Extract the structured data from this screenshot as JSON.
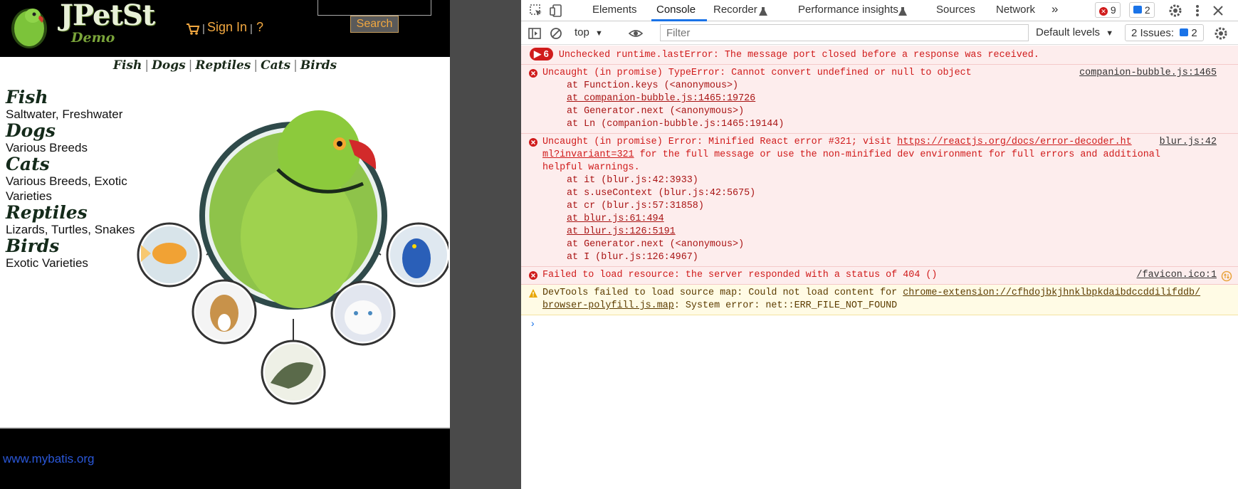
{
  "page": {
    "logo_text": "JPetSt",
    "logo_demo": "Demo",
    "sign_in": "Sign In",
    "help": "?",
    "search_button": "Search",
    "search_value": "",
    "quicklinks": [
      "Fish",
      "Dogs",
      "Reptiles",
      "Cats",
      "Birds"
    ],
    "categories": [
      {
        "title": "Fish",
        "desc": "Saltwater, Freshwater"
      },
      {
        "title": "Dogs",
        "desc": "Various Breeds"
      },
      {
        "title": "Cats",
        "desc": "Various Breeds, Exotic Varieties"
      },
      {
        "title": "Reptiles",
        "desc": "Lizards, Turtles, Snakes"
      },
      {
        "title": "Birds",
        "desc": "Exotic Varieties"
      }
    ],
    "footer_link": "www.mybatis.org"
  },
  "devtools": {
    "tabs": [
      "Elements",
      "Console",
      "Recorder",
      "Performance insights",
      "Sources",
      "Network"
    ],
    "active_tab": "Console",
    "more_tabs": "»",
    "error_count": "9",
    "message_count": "2",
    "context": "top",
    "filter_placeholder": "Filter",
    "default_levels": "Default levels",
    "issues_label": "2 Issues:",
    "issues_count": "2",
    "messages": {
      "m1": {
        "count": "6",
        "text": "Unchecked runtime.lastError: The message port closed before a response was received."
      },
      "m2": {
        "text": "Uncaught (in promise) TypeError: Cannot convert undefined or null to object",
        "source": "companion-bubble.js:1465",
        "stack": [
          "at Function.keys (<anonymous>)",
          "at companion-bubble.js:1465:19726",
          "at Generator.next (<anonymous>)",
          "at Ln (companion-bubble.js:1465:19144)"
        ]
      },
      "m3": {
        "text1": "Uncaught (in promise) Error: Minified React error #321; visit ",
        "link": "https://reactjs.org/docs/error-decoder.ht",
        "link2": "ml?invariant=321",
        "text2": " for the full message or use the non-minified dev environment for full errors and additional helpful warnings.",
        "source": "blur.js:42",
        "stack": [
          "at it (blur.js:42:3933)",
          "at s.useContext (blur.js:42:5675)",
          "at cr (blur.js:57:31858)",
          "at blur.js:61:494",
          "at blur.js:126:5191",
          "at Generator.next (<anonymous>)",
          "at I (blur.js:126:4967)"
        ]
      },
      "m4": {
        "text": "Failed to load resource: the server responded with a status of 404 ()",
        "source": "/favicon.ico:1"
      },
      "m5": {
        "text1": "DevTools failed to load source map: Could not load content for ",
        "link": "chrome-extension://cfhdojbkjhnklbpkdaibdccddilifddb/",
        "link2": "browser-polyfill.js.map",
        "text2": ": System error: net::ERR_FILE_NOT_FOUND"
      }
    },
    "prompt": "›"
  },
  "colors": {
    "accent": "#1a73e8",
    "error": "#d01b1b",
    "error_bg": "#fdeded",
    "warn_bg": "#fffbe5",
    "header_bg": "#000000",
    "link_orange": "#f2a840"
  }
}
